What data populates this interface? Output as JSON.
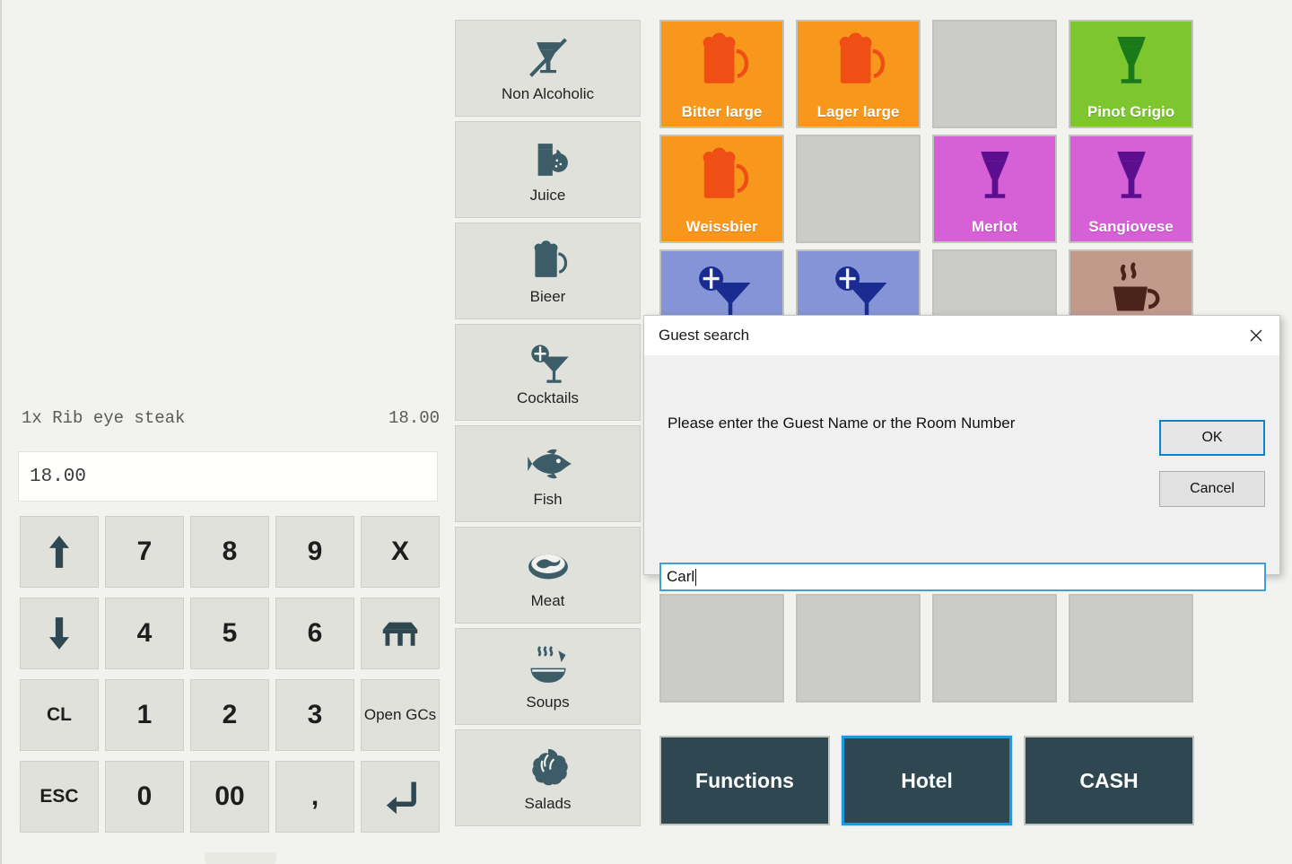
{
  "order": {
    "line_item": "1x Rib eye steak",
    "line_price": "18.00",
    "amount_display": "18.00"
  },
  "keypad": {
    "keys": [
      {
        "label": "",
        "icon": "arrow-up-icon",
        "name": "scroll-up-key",
        "style": "icon"
      },
      {
        "label": "7",
        "icon": "",
        "name": "digit-7-key",
        "style": "digit"
      },
      {
        "label": "8",
        "icon": "",
        "name": "digit-8-key",
        "style": "digit"
      },
      {
        "label": "9",
        "icon": "",
        "name": "digit-9-key",
        "style": "digit"
      },
      {
        "label": "X",
        "icon": "",
        "name": "multiply-key",
        "style": "digit"
      },
      {
        "label": "",
        "icon": "arrow-down-icon",
        "name": "scroll-down-key",
        "style": "icon"
      },
      {
        "label": "4",
        "icon": "",
        "name": "digit-4-key",
        "style": "digit"
      },
      {
        "label": "5",
        "icon": "",
        "name": "digit-5-key",
        "style": "digit"
      },
      {
        "label": "6",
        "icon": "",
        "name": "digit-6-key",
        "style": "digit"
      },
      {
        "label": "",
        "icon": "table-icon",
        "name": "table-key",
        "style": "icon"
      },
      {
        "label": "CL",
        "icon": "",
        "name": "clear-key",
        "style": "small"
      },
      {
        "label": "1",
        "icon": "",
        "name": "digit-1-key",
        "style": "digit"
      },
      {
        "label": "2",
        "icon": "",
        "name": "digit-2-key",
        "style": "digit"
      },
      {
        "label": "3",
        "icon": "",
        "name": "digit-3-key",
        "style": "digit"
      },
      {
        "label": "Open\nGCs",
        "icon": "",
        "name": "open-gcs-key",
        "style": "tiny"
      },
      {
        "label": "ESC",
        "icon": "",
        "name": "escape-key",
        "style": "small"
      },
      {
        "label": "0",
        "icon": "",
        "name": "digit-0-key",
        "style": "digit"
      },
      {
        "label": "00",
        "icon": "",
        "name": "digit-00-key",
        "style": "digit"
      },
      {
        "label": ",",
        "icon": "",
        "name": "decimal-comma-key",
        "style": "digit"
      },
      {
        "label": "",
        "icon": "enter-icon",
        "name": "enter-key",
        "style": "icon"
      }
    ]
  },
  "categories": [
    {
      "label": "Non Alcoholic",
      "icon": "no-alcohol-glass-icon",
      "name": "category-non-alcoholic"
    },
    {
      "label": "Juice",
      "icon": "juice-glass-icon",
      "name": "category-juice"
    },
    {
      "label": "Bieer",
      "icon": "beer-mug-icon",
      "name": "category-bieer"
    },
    {
      "label": "Cocktails",
      "icon": "cocktail-glass-icon",
      "name": "category-cocktails"
    },
    {
      "label": "Fish",
      "icon": "fish-icon",
      "name": "category-fish"
    },
    {
      "label": "Meat",
      "icon": "steak-icon",
      "name": "category-meat"
    },
    {
      "label": "Soups",
      "icon": "soup-bowl-icon",
      "name": "category-soups"
    },
    {
      "label": "Salads",
      "icon": "lettuce-icon",
      "name": "category-salads"
    }
  ],
  "products": [
    {
      "label": "Bitter large",
      "icon": "beer-mug-icon",
      "bg": "#f7981d",
      "fg": "#ef4e15",
      "name": "product-bitter-large"
    },
    {
      "label": "Lager large",
      "icon": "beer-mug-icon",
      "bg": "#f7981d",
      "fg": "#ef4e15",
      "name": "product-lager-large"
    },
    {
      "label": "",
      "icon": "",
      "bg": "#cbcbc8",
      "fg": "",
      "name": "product-empty-1"
    },
    {
      "label": "Pinot Grigio",
      "icon": "wine-glass-icon",
      "bg": "#7dc62e",
      "fg": "#1a7a1a",
      "name": "product-pinot-grigio"
    },
    {
      "label": "Weissbier",
      "icon": "beer-mug-icon",
      "bg": "#f7981d",
      "fg": "#ef4e15",
      "name": "product-weissbier"
    },
    {
      "label": "",
      "icon": "",
      "bg": "#cbcbc8",
      "fg": "",
      "name": "product-empty-2"
    },
    {
      "label": "Merlot",
      "icon": "wine-glass-icon",
      "bg": "#d660d6",
      "fg": "#5b0f8f",
      "name": "product-merlot"
    },
    {
      "label": "Sangiovese",
      "icon": "wine-glass-icon",
      "bg": "#d660d6",
      "fg": "#5b0f8f",
      "name": "product-sangiovese"
    },
    {
      "label": "",
      "icon": "cocktail-glass-icon",
      "bg": "#8494d6",
      "fg": "#1a2c8f",
      "name": "product-cocktail-1"
    },
    {
      "label": "",
      "icon": "cocktail-glass-icon",
      "bg": "#8494d6",
      "fg": "#1a2c8f",
      "name": "product-cocktail-2"
    },
    {
      "label": "",
      "icon": "",
      "bg": "#cbcbc8",
      "fg": "",
      "name": "product-empty-3"
    },
    {
      "label": "",
      "icon": "coffee-cup-icon",
      "bg": "#c29a8c",
      "fg": "#4a241b",
      "name": "product-coffee"
    },
    {
      "label": "",
      "icon": "",
      "bg": "#cbcbc8",
      "fg": "",
      "name": "product-hidden-1"
    },
    {
      "label": "",
      "icon": "",
      "bg": "#cbcbc8",
      "fg": "",
      "name": "product-hidden-2"
    },
    {
      "label": "",
      "icon": "",
      "bg": "#cbcbc8",
      "fg": "",
      "name": "product-hidden-3"
    },
    {
      "label": "",
      "icon": "",
      "bg": "#cbcbc8",
      "fg": "",
      "name": "product-hidden-4"
    },
    {
      "label": "",
      "icon": "",
      "bg": "#f5a304",
      "fg": "",
      "name": "product-orange-1"
    },
    {
      "label": "",
      "icon": "",
      "bg": "#f5a304",
      "fg": "",
      "name": "product-orange-2"
    },
    {
      "label": "",
      "icon": "",
      "bg": "#f5a304",
      "fg": "",
      "name": "product-orange-3"
    },
    {
      "label": "",
      "icon": "",
      "bg": "#b9b9b6",
      "fg": "",
      "name": "product-empty-4"
    },
    {
      "label": "",
      "icon": "",
      "bg": "#cbcbc8",
      "fg": "",
      "name": "product-empty-5"
    },
    {
      "label": "",
      "icon": "",
      "bg": "#cbcbc8",
      "fg": "",
      "name": "product-empty-6"
    },
    {
      "label": "",
      "icon": "",
      "bg": "#cbcbc8",
      "fg": "",
      "name": "product-empty-7"
    },
    {
      "label": "",
      "icon": "",
      "bg": "#cbcbc8",
      "fg": "",
      "name": "product-empty-8"
    }
  ],
  "actions": [
    {
      "label": "Functions",
      "name": "functions-button",
      "focused": false
    },
    {
      "label": "Hotel",
      "name": "hotel-button",
      "focused": true
    },
    {
      "label": "CASH",
      "name": "cash-button",
      "focused": false
    }
  ],
  "dialog": {
    "title": "Guest search",
    "close_icon": "close-icon",
    "prompt": "Please enter the Guest Name or the Room Number",
    "ok_label": "OK",
    "cancel_label": "Cancel",
    "input_value": "Carl"
  },
  "colors": {
    "accent_blue": "#0a85d1",
    "focus_blue": "#1e9ae0",
    "panel_bg": "#f2f2ee",
    "button_bg": "#e1e1dc",
    "dark_teal": "#2e4750"
  }
}
